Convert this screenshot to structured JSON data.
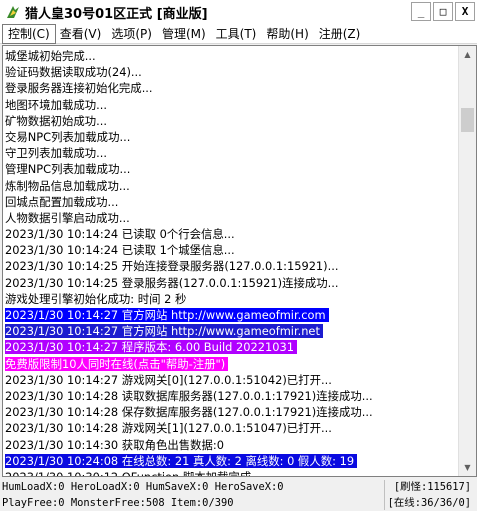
{
  "window": {
    "title": "猎人皇30号01区正式 [商业版]",
    "minimize": "_",
    "maximize": "□",
    "close": "X"
  },
  "menu": [
    "控制(C)",
    "查看(V)",
    "选项(P)",
    "管理(M)",
    "工具(T)",
    "帮助(H)",
    "注册(Z)"
  ],
  "log": [
    {
      "text": "城堡城初始完成...",
      "style": ""
    },
    {
      "text": "验证码数据读取成功(24)...",
      "style": ""
    },
    {
      "text": "登录服务器连接初始化完成...",
      "style": ""
    },
    {
      "text": "地图环境加载成功...",
      "style": ""
    },
    {
      "text": "矿物数据初始成功...",
      "style": ""
    },
    {
      "text": "交易NPC列表加载成功...",
      "style": ""
    },
    {
      "text": "守卫列表加载成功...",
      "style": ""
    },
    {
      "text": "管理NPC列表加载成功...",
      "style": ""
    },
    {
      "text": "炼制物品信息加载成功...",
      "style": ""
    },
    {
      "text": "回城点配置加载成功...",
      "style": ""
    },
    {
      "text": "人物数据引擎启动成功...",
      "style": ""
    },
    {
      "text": "2023/1/30 10:14:24 已读取 0个行会信息...",
      "style": ""
    },
    {
      "text": "2023/1/30 10:14:24 已读取 1个城堡信息...",
      "style": ""
    },
    {
      "text": "2023/1/30 10:14:25 开始连接登录服务器(127.0.0.1:15921)...",
      "style": ""
    },
    {
      "text": "2023/1/30 10:14:25 登录服务器(127.0.0.1:15921)连接成功...",
      "style": ""
    },
    {
      "text": "游戏处理引擎初始化成功: 时间 2 秒",
      "style": ""
    },
    {
      "text": "2023/1/30 10:14:27 官方网站 http://www.gameofmir.com",
      "style": "hl-blue"
    },
    {
      "text": "2023/1/30 10:14:27 官方网站 http://www.gameofmir.net",
      "style": "hl-blue2"
    },
    {
      "text": "2023/1/30 10:14:27 程序版本: 6.00 Build 20221031",
      "style": "hl-purple"
    },
    {
      "text": "免费版限制10人同时在线(点击\"帮助-注册\")",
      "style": "hl-magenta"
    },
    {
      "text": "2023/1/30 10:14:27 游戏网关[0](127.0.0.1:51042)已打开...",
      "style": ""
    },
    {
      "text": "2023/1/30 10:14:28 读取数据库服务器(127.0.0.1:17921)连接成功...",
      "style": ""
    },
    {
      "text": "2023/1/30 10:14:28 保存数据库服务器(127.0.0.1:17921)连接成功...",
      "style": ""
    },
    {
      "text": "2023/1/30 10:14:28 游戏网关[1](127.0.0.1:51047)已打开...",
      "style": ""
    },
    {
      "text": "2023/1/30 10:14:30 获取角色出售数据:0",
      "style": ""
    },
    {
      "text": "2023/1/30 10:24:08 在线总数: 21 真人数: 2 离线数: 0 假人数: 19",
      "style": "hl-darkblue"
    },
    {
      "text": "2023/1/30 10:30:12 QFunction 脚本加载完成",
      "style": ""
    }
  ],
  "status": {
    "row1_left": "HumLoadX:0 HeroLoadX:0 HumSaveX:0 HeroSaveX:0",
    "row1_right": "[刷怪:115617]",
    "row2_left": "PlayFree:0 MonsterFree:508 Item:0/390",
    "row2_right": "[在线:36/36/0]"
  }
}
